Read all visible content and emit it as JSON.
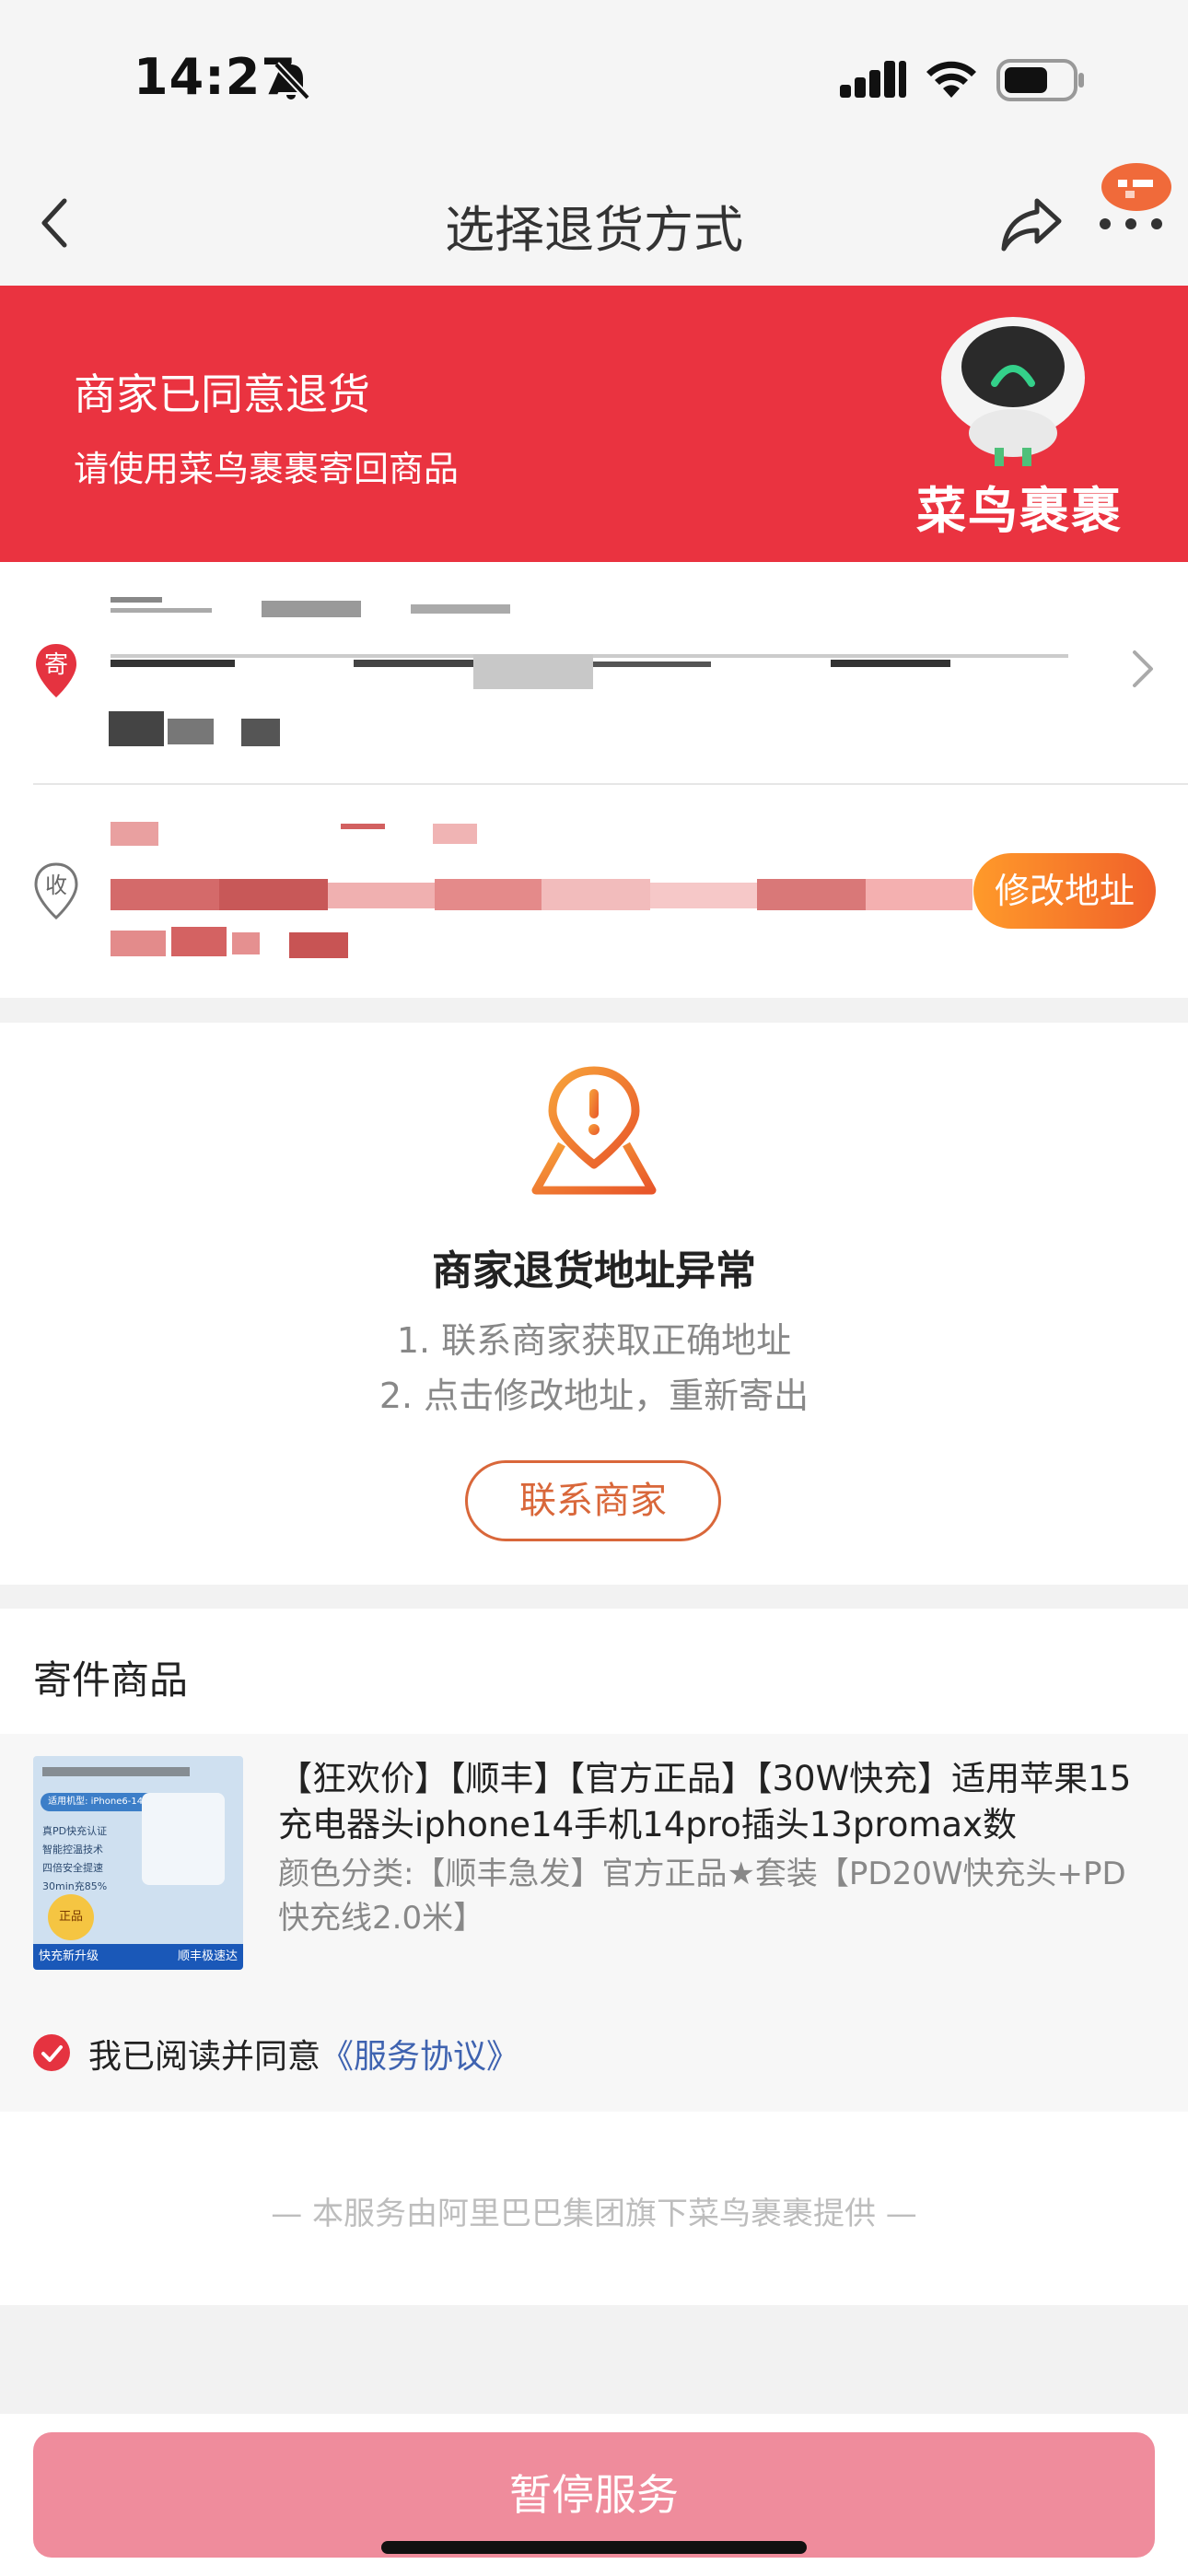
{
  "status_bar": {
    "time": "14:27"
  },
  "nav": {
    "title": "选择退货方式"
  },
  "banner": {
    "title": "商家已同意退货",
    "subtitle": "请使用菜鸟裹裹寄回商品",
    "brand": "菜鸟裹裹",
    "color": "#ea3340"
  },
  "address": {
    "sender_badge": "寄",
    "receiver_badge": "收",
    "edit_button": "修改地址"
  },
  "warning": {
    "title": "商家退货地址异常",
    "lines": [
      "1. 联系商家获取正确地址",
      "2. 点击修改地址，重新寄出"
    ],
    "contact_button": "联系商家"
  },
  "items": {
    "section_title": "寄件商品",
    "product": {
      "title": "【狂欢价】【顺丰】【官方正品】【30W快充】适用苹果15充电器头iphone14手机14pro插头13promax数",
      "spec": "颜色分类:【顺丰急发】官方正品★套装【PD20W快充头+PD快充线2.0米】",
      "thumb_tag": "适用机型: iPhone6-14系iPad",
      "thumb_features": [
        "真PD快充认证",
        "智能控温技术",
        "四倍安全提速",
        "30min充85%"
      ],
      "thumb_badge": "正品",
      "thumb_banner_left": "快充新升级",
      "thumb_banner_right": "顺丰极速达"
    }
  },
  "agreement": {
    "text": "我已阅读并同意",
    "link": "《服务协议》",
    "checked": true
  },
  "footer": {
    "note": "—    本服务由阿里巴巴集团旗下菜鸟裹裹提供    —"
  },
  "bottom": {
    "button": "暂停服务",
    "button_color": "#ef8c9c"
  }
}
